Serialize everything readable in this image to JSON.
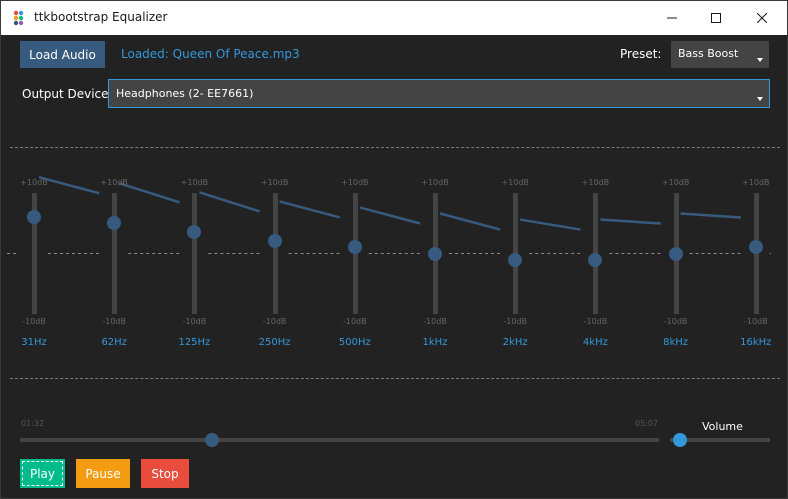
{
  "window": {
    "title": "ttkbootstrap Equalizer"
  },
  "toolbar": {
    "load_button": "Load Audio",
    "loaded_text": "Loaded: Queen Of Peace.mp3",
    "preset_label": "Preset:",
    "preset_value": "Bass Boost"
  },
  "output": {
    "label": "Output Device:",
    "device": "Headphones (2- EE7661)"
  },
  "equalizer": {
    "max_label": "+10dB",
    "min_label": "-10dB",
    "bands": [
      {
        "freq": "31Hz",
        "gain": 6
      },
      {
        "freq": "62Hz",
        "gain": 5
      },
      {
        "freq": "125Hz",
        "gain": 3.5
      },
      {
        "freq": "250Hz",
        "gain": 2
      },
      {
        "freq": "500Hz",
        "gain": 1
      },
      {
        "freq": "1kHz",
        "gain": 0
      },
      {
        "freq": "2kHz",
        "gain": -1
      },
      {
        "freq": "4kHz",
        "gain": -1
      },
      {
        "freq": "8kHz",
        "gain": 0
      },
      {
        "freq": "16kHz",
        "gain": 1
      }
    ]
  },
  "playback": {
    "current_time": "01:32",
    "total_time": "05:07",
    "progress": 0.3,
    "volume_label": "Volume",
    "volume": 0.05,
    "play_label": "Play",
    "pause_label": "Pause",
    "stop_label": "Stop"
  },
  "colors": {
    "primary": "#375a7f",
    "info": "#3498db",
    "success": "#00bc8c",
    "warning": "#f39c12",
    "danger": "#e74c3c"
  }
}
